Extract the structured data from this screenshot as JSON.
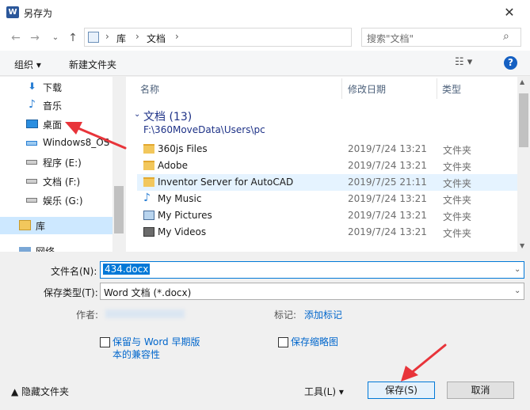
{
  "window": {
    "title": "另存为",
    "app_icon": "word-icon",
    "close_glyph": "✕"
  },
  "nav": {
    "back": "←",
    "forward": "→",
    "up_dropdown": "⌄",
    "up": "↑",
    "breadcrumbs": [
      "库",
      "文档"
    ],
    "refresh": "↻",
    "search_placeholder": "搜索\"文档\"",
    "search_icon": "⌕"
  },
  "toolbar": {
    "organize": "组织 ▾",
    "new_folder": "新建文件夹",
    "view": "☷ ▾",
    "help": "?"
  },
  "sidebar": {
    "items": [
      {
        "label": "下载",
        "icon": "download-icon"
      },
      {
        "label": "音乐",
        "icon": "music-icon"
      },
      {
        "label": "桌面",
        "icon": "desktop-icon"
      },
      {
        "label": "Windows8_OS",
        "icon": "drive-icon"
      },
      {
        "label": "程序 (E:)",
        "icon": "drive-icon"
      },
      {
        "label": "文档 (F:)",
        "icon": "drive-icon"
      },
      {
        "label": "娱乐 (G:)",
        "icon": "drive-icon"
      },
      {
        "label": "库",
        "icon": "library-icon"
      },
      {
        "label": "网络",
        "icon": "network-icon"
      }
    ]
  },
  "filelist": {
    "columns": [
      "名称",
      "修改日期",
      "类型"
    ],
    "group": {
      "title": "文档 (13)",
      "path": "F:\\360MoveData\\Users\\pc"
    },
    "rows": [
      {
        "name": "360js Files",
        "date": "2019/7/24 13:21",
        "type": "文件夹",
        "icon": "folder-icon"
      },
      {
        "name": "Adobe",
        "date": "2019/7/24 13:21",
        "type": "文件夹",
        "icon": "folder-icon"
      },
      {
        "name": "Inventor Server for AutoCAD",
        "date": "2019/7/25 21:11",
        "type": "文件夹",
        "icon": "folder-icon"
      },
      {
        "name": "My Music",
        "date": "2019/7/24 13:21",
        "type": "文件夹",
        "icon": "music-folder-icon"
      },
      {
        "name": "My Pictures",
        "date": "2019/7/24 13:21",
        "type": "文件夹",
        "icon": "pictures-folder-icon"
      },
      {
        "name": "My Videos",
        "date": "2019/7/24 13:21",
        "type": "文件夹",
        "icon": "videos-folder-icon"
      }
    ],
    "selected_row": 2
  },
  "form": {
    "filename_label": "文件名(N):",
    "filename_value": "434.docx",
    "type_label": "保存类型(T):",
    "type_value": "Word 文档 (*.docx)",
    "author_label": "作者:",
    "tags_label": "标记:",
    "add_tag": "添加标记",
    "compat_label_line1": "保留与 Word 早期版",
    "compat_label_line2": "本的兼容性",
    "thumbnail_label": "保存缩略图"
  },
  "footer": {
    "hide_folders": "▲  隐藏文件夹",
    "tools": "工具(L)   ▾",
    "save": "保存(S)",
    "cancel": "取消"
  },
  "colors": {
    "accent": "#0078d7",
    "link": "#0066cc",
    "group": "#1e3287",
    "annotation": "#e8343a"
  }
}
